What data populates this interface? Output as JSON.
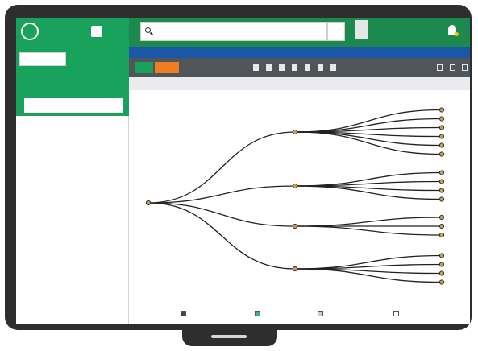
{
  "header": {
    "logo_text": "",
    "search_placeholder": "",
    "user_name": "",
    "user_menu": ""
  },
  "sidebar": {
    "top_button": "",
    "item": "",
    "subitem": ""
  },
  "main": {
    "notice": "",
    "toolbar_button_1": "",
    "toolbar_button_2": "",
    "breadcrumb": ""
  },
  "icons": {
    "logo": "globe-icon",
    "search": "search-icon",
    "bell": "bell-icon",
    "user": "avatar-icon"
  },
  "colors": {
    "brand_green": "#19a25b",
    "header_green": "#1c8a4e",
    "notice_blue": "#1b57a6",
    "toolbar_gray": "#50555a",
    "accent_orange": "#ef7d22",
    "node_fill": "#c9a04a"
  },
  "tree": {
    "root": {
      "label": "",
      "children": [
        {
          "label": "",
          "children": [
            {
              "label": ""
            },
            {
              "label": ""
            },
            {
              "label": ""
            },
            {
              "label": ""
            },
            {
              "label": ""
            },
            {
              "label": ""
            }
          ]
        },
        {
          "label": "",
          "children": [
            {
              "label": ""
            },
            {
              "label": ""
            },
            {
              "label": ""
            },
            {
              "label": ""
            }
          ]
        },
        {
          "label": "",
          "children": [
            {
              "label": ""
            },
            {
              "label": ""
            },
            {
              "label": ""
            }
          ]
        },
        {
          "label": "",
          "children": [
            {
              "label": ""
            },
            {
              "label": ""
            },
            {
              "label": ""
            },
            {
              "label": ""
            }
          ]
        }
      ]
    }
  },
  "legend": [
    {
      "label": "",
      "color": "#444444"
    },
    {
      "label": "",
      "color": "#3fb37a"
    },
    {
      "label": "",
      "color": "#cccccc"
    },
    {
      "label": "",
      "color": "#ffffff"
    }
  ]
}
